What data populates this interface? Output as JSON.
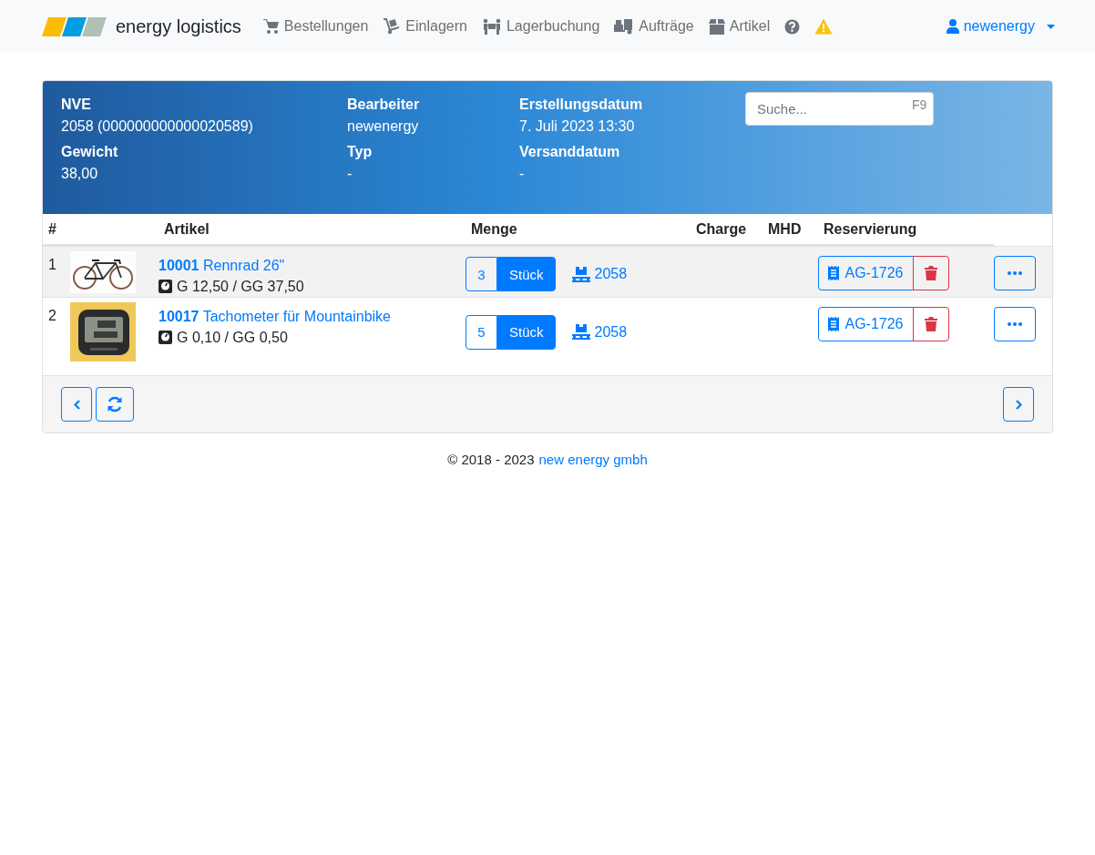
{
  "navbar": {
    "brand": "energy logistics",
    "items": [
      {
        "label": "Bestellungen"
      },
      {
        "label": "Einlagern"
      },
      {
        "label": "Lagerbuchung"
      },
      {
        "label": "Aufträge"
      },
      {
        "label": "Artikel"
      }
    ],
    "user": "newenergy"
  },
  "header": {
    "fields": [
      {
        "label": "NVE",
        "value": "2058 (000000000000020589)"
      },
      {
        "label": "Bearbeiter",
        "value": "newenergy"
      },
      {
        "label": "Erstellungsdatum",
        "value": "7. Juli 2023 13:30"
      },
      {
        "label": "Gewicht",
        "value": "38,00"
      },
      {
        "label": "Typ",
        "value": "-"
      },
      {
        "label": "Versanddatum",
        "value": "-"
      }
    ],
    "search": {
      "placeholder": "Suche...",
      "shortcut": "F9"
    }
  },
  "table": {
    "columns": [
      "#",
      "Artikel",
      "Menge",
      "Charge",
      "MHD",
      "Reservierung"
    ],
    "rows": [
      {
        "index": "1",
        "selected": true,
        "picture": {
          "kind": "bicycle"
        },
        "article_no": "10001",
        "name": "Rennrad 26\"",
        "weight": "G 12,50 / GG 37,50",
        "quantity": "3",
        "unit": "Stück",
        "pallet": "2058",
        "reservation": "AG-1726"
      },
      {
        "index": "2",
        "selected": false,
        "picture": {
          "kind": "device"
        },
        "article_no": "10017",
        "name": "Tachometer für Mountainbike",
        "weight": "G 0,10 / GG 0,50",
        "quantity": "5",
        "unit": "Stück",
        "pallet": "2058",
        "reservation": "AG-1726"
      }
    ]
  },
  "footer": {
    "copyright": "© 2018 - 2023",
    "company": "new energy gmbh"
  }
}
